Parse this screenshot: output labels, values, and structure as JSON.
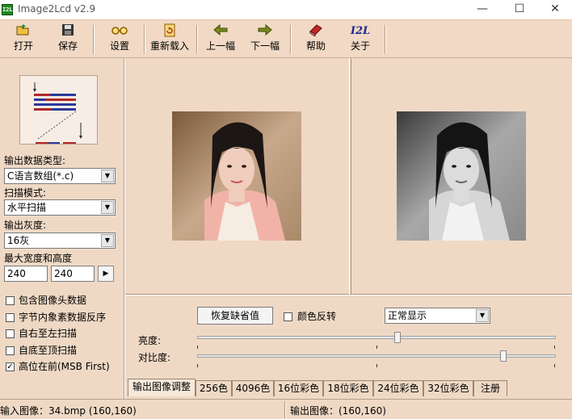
{
  "window": {
    "icon_text": "I2L",
    "title": "Image2Lcd v2.9",
    "minimize": "—",
    "maximize": "☐",
    "close": "✕"
  },
  "toolbar": {
    "open": "打开",
    "save": "保存",
    "settings": "设置",
    "reload": "重新载入",
    "prev": "上一幅",
    "next": "下一幅",
    "help": "帮助",
    "about": "关于",
    "about_icon_text": "I2L"
  },
  "left": {
    "output_type_label": "输出数据类型:",
    "output_type_value": "C语言数组(*.c)",
    "scan_mode_label": "扫描模式:",
    "scan_mode_value": "水平扫描",
    "gray_label": "输出灰度:",
    "gray_value": "16灰",
    "maxsize_label": "最大宽度和高度",
    "max_width": "240",
    "max_height": "240",
    "options": [
      {
        "label": "包含图像头数据",
        "checked": false
      },
      {
        "label": "字节内象素数据反序",
        "checked": false
      },
      {
        "label": "自右至左扫描",
        "checked": false
      },
      {
        "label": "自底至顶扫描",
        "checked": false
      },
      {
        "label": "高位在前(MSB First)",
        "checked": true
      }
    ],
    "check_mark": "✓"
  },
  "controls": {
    "restore_default": "恢复缺省值",
    "invert_label": "颜色反转",
    "invert_checked": false,
    "display_mode": "正常显示",
    "brightness_label": "亮度:",
    "contrast_label": "对比度:",
    "brightness_level": 0.56,
    "contrast_level": 0.86
  },
  "tabs": [
    "输出图像调整",
    "256色",
    "4096色",
    "16位彩色",
    "18位彩色",
    "24位彩色",
    "32位彩色",
    "注册"
  ],
  "status": {
    "input_image": "输入图像：34.bmp (160,160)",
    "output_image": "输出图像：(160,160)"
  },
  "colors": {
    "panel_bg": "#efd9c5",
    "photo_skin": "#e9b9a4",
    "photo_hair": "#1c1614"
  }
}
